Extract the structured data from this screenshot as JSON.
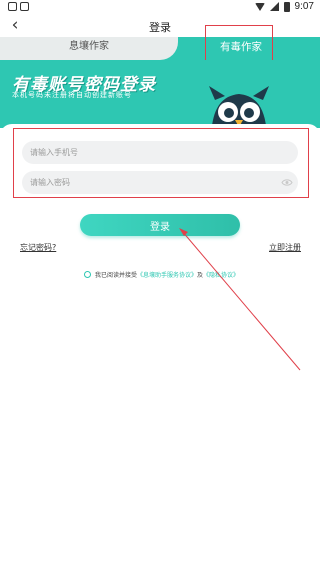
{
  "status_bar": {
    "time": "9:07"
  },
  "nav": {
    "title": "登录"
  },
  "tabs": [
    {
      "label": "息壤作家",
      "active": false
    },
    {
      "label": "有毒作家",
      "active": true
    }
  ],
  "banner": {
    "title": "有毒账号密码登录",
    "subtitle": "本机号码未注册将自动创建新账号"
  },
  "form": {
    "phone_placeholder": "请输入手机号",
    "password_placeholder": "请输入密码",
    "login_label": "登录"
  },
  "links": {
    "forgot": "忘记密码?",
    "register": "立即注册"
  },
  "agreement": {
    "prefix": "我已阅读并接受",
    "service_link": "《息壤助手服务协议》",
    "and": "及",
    "privacy_link": "《隐私协议》"
  },
  "colors": {
    "accent": "#2ec7b2",
    "annotation": "#e0404a"
  }
}
